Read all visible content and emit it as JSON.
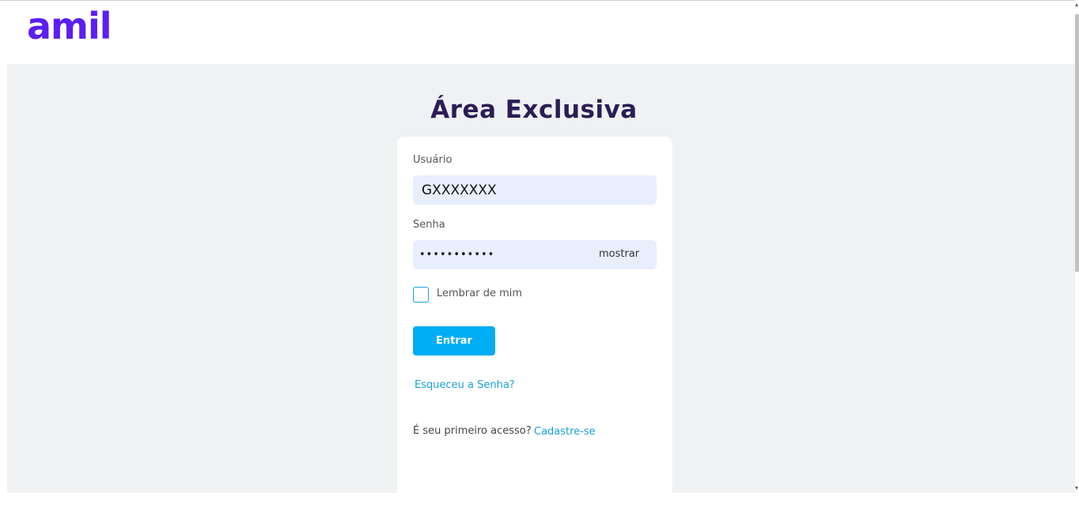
{
  "header": {
    "logo_text": "amil",
    "brand_color": "#5b1ff2"
  },
  "main": {
    "title": "Área Exclusiva"
  },
  "login_form": {
    "username_label": "Usuário",
    "username_value": "GXXXXXXX",
    "password_label": "Senha",
    "password_value": "•••••••••••",
    "show_password_label": "mostrar",
    "remember_label": "Lembrar de mim",
    "remember_checked": false,
    "submit_label": "Entrar",
    "forgot_link": "Esqueceu a Senha?",
    "first_access_text": "É seu primeiro acesso?",
    "signup_link": "Cadastre-se"
  },
  "colors": {
    "title": "#2b1d55",
    "primary_button": "#00adf5",
    "link": "#1aa0dc",
    "input_background": "#e8eefc",
    "page_background": "#f0f1f3"
  }
}
